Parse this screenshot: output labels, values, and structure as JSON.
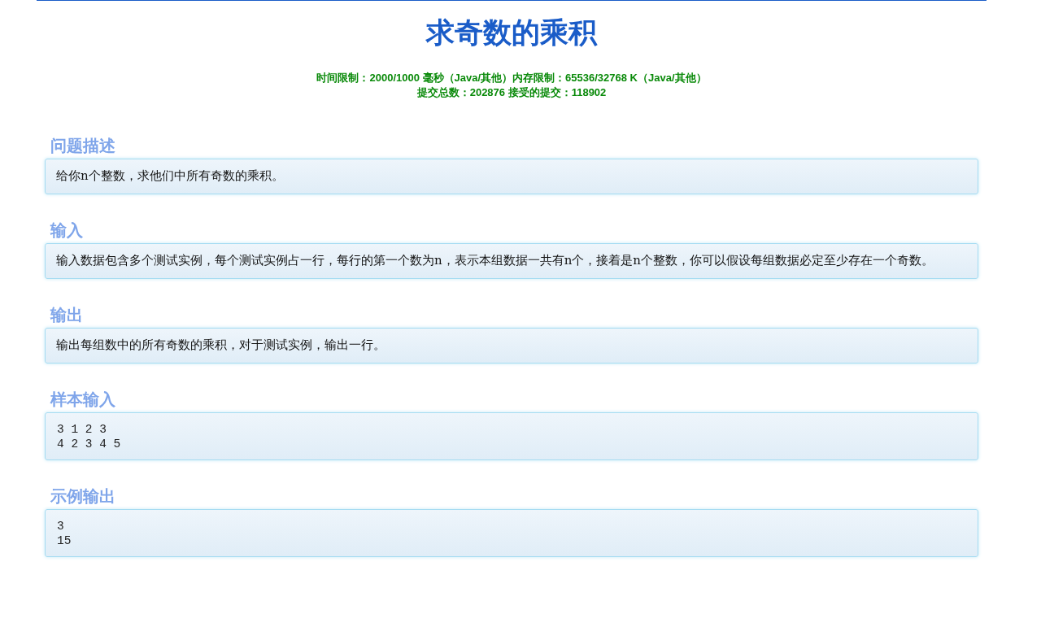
{
  "title": "求奇数的乘积",
  "limits": [
    "时间限制：2000/1000 毫秒（Java/其他）内存限制：65536/32768 K（Java/其他）",
    "提交总数：202876 接受的提交：118902"
  ],
  "sections": [
    {
      "heading": "问题描述",
      "kind": "text",
      "lines": [
        "给你n个整数，求他们中所有奇数的乘积。"
      ]
    },
    {
      "heading": "输入",
      "kind": "text",
      "lines": [
        "输入数据包含多个测试实例，每个测试实例占一行，每行的第一个数为n，表示本组数据一共有n个，接着是n个整数，你可以假设每组数据必定至少存在一个奇数。"
      ]
    },
    {
      "heading": "输出",
      "kind": "text",
      "lines": [
        "输出每组数中的所有奇数的乘积，对于测试实例，输出一行。"
      ]
    },
    {
      "heading": "样本输入",
      "kind": "code",
      "lines": [
        "3 1 2 3",
        "4 2 3 4 5"
      ]
    },
    {
      "heading": "示例输出",
      "kind": "code",
      "lines": [
        "3",
        "15"
      ]
    }
  ]
}
